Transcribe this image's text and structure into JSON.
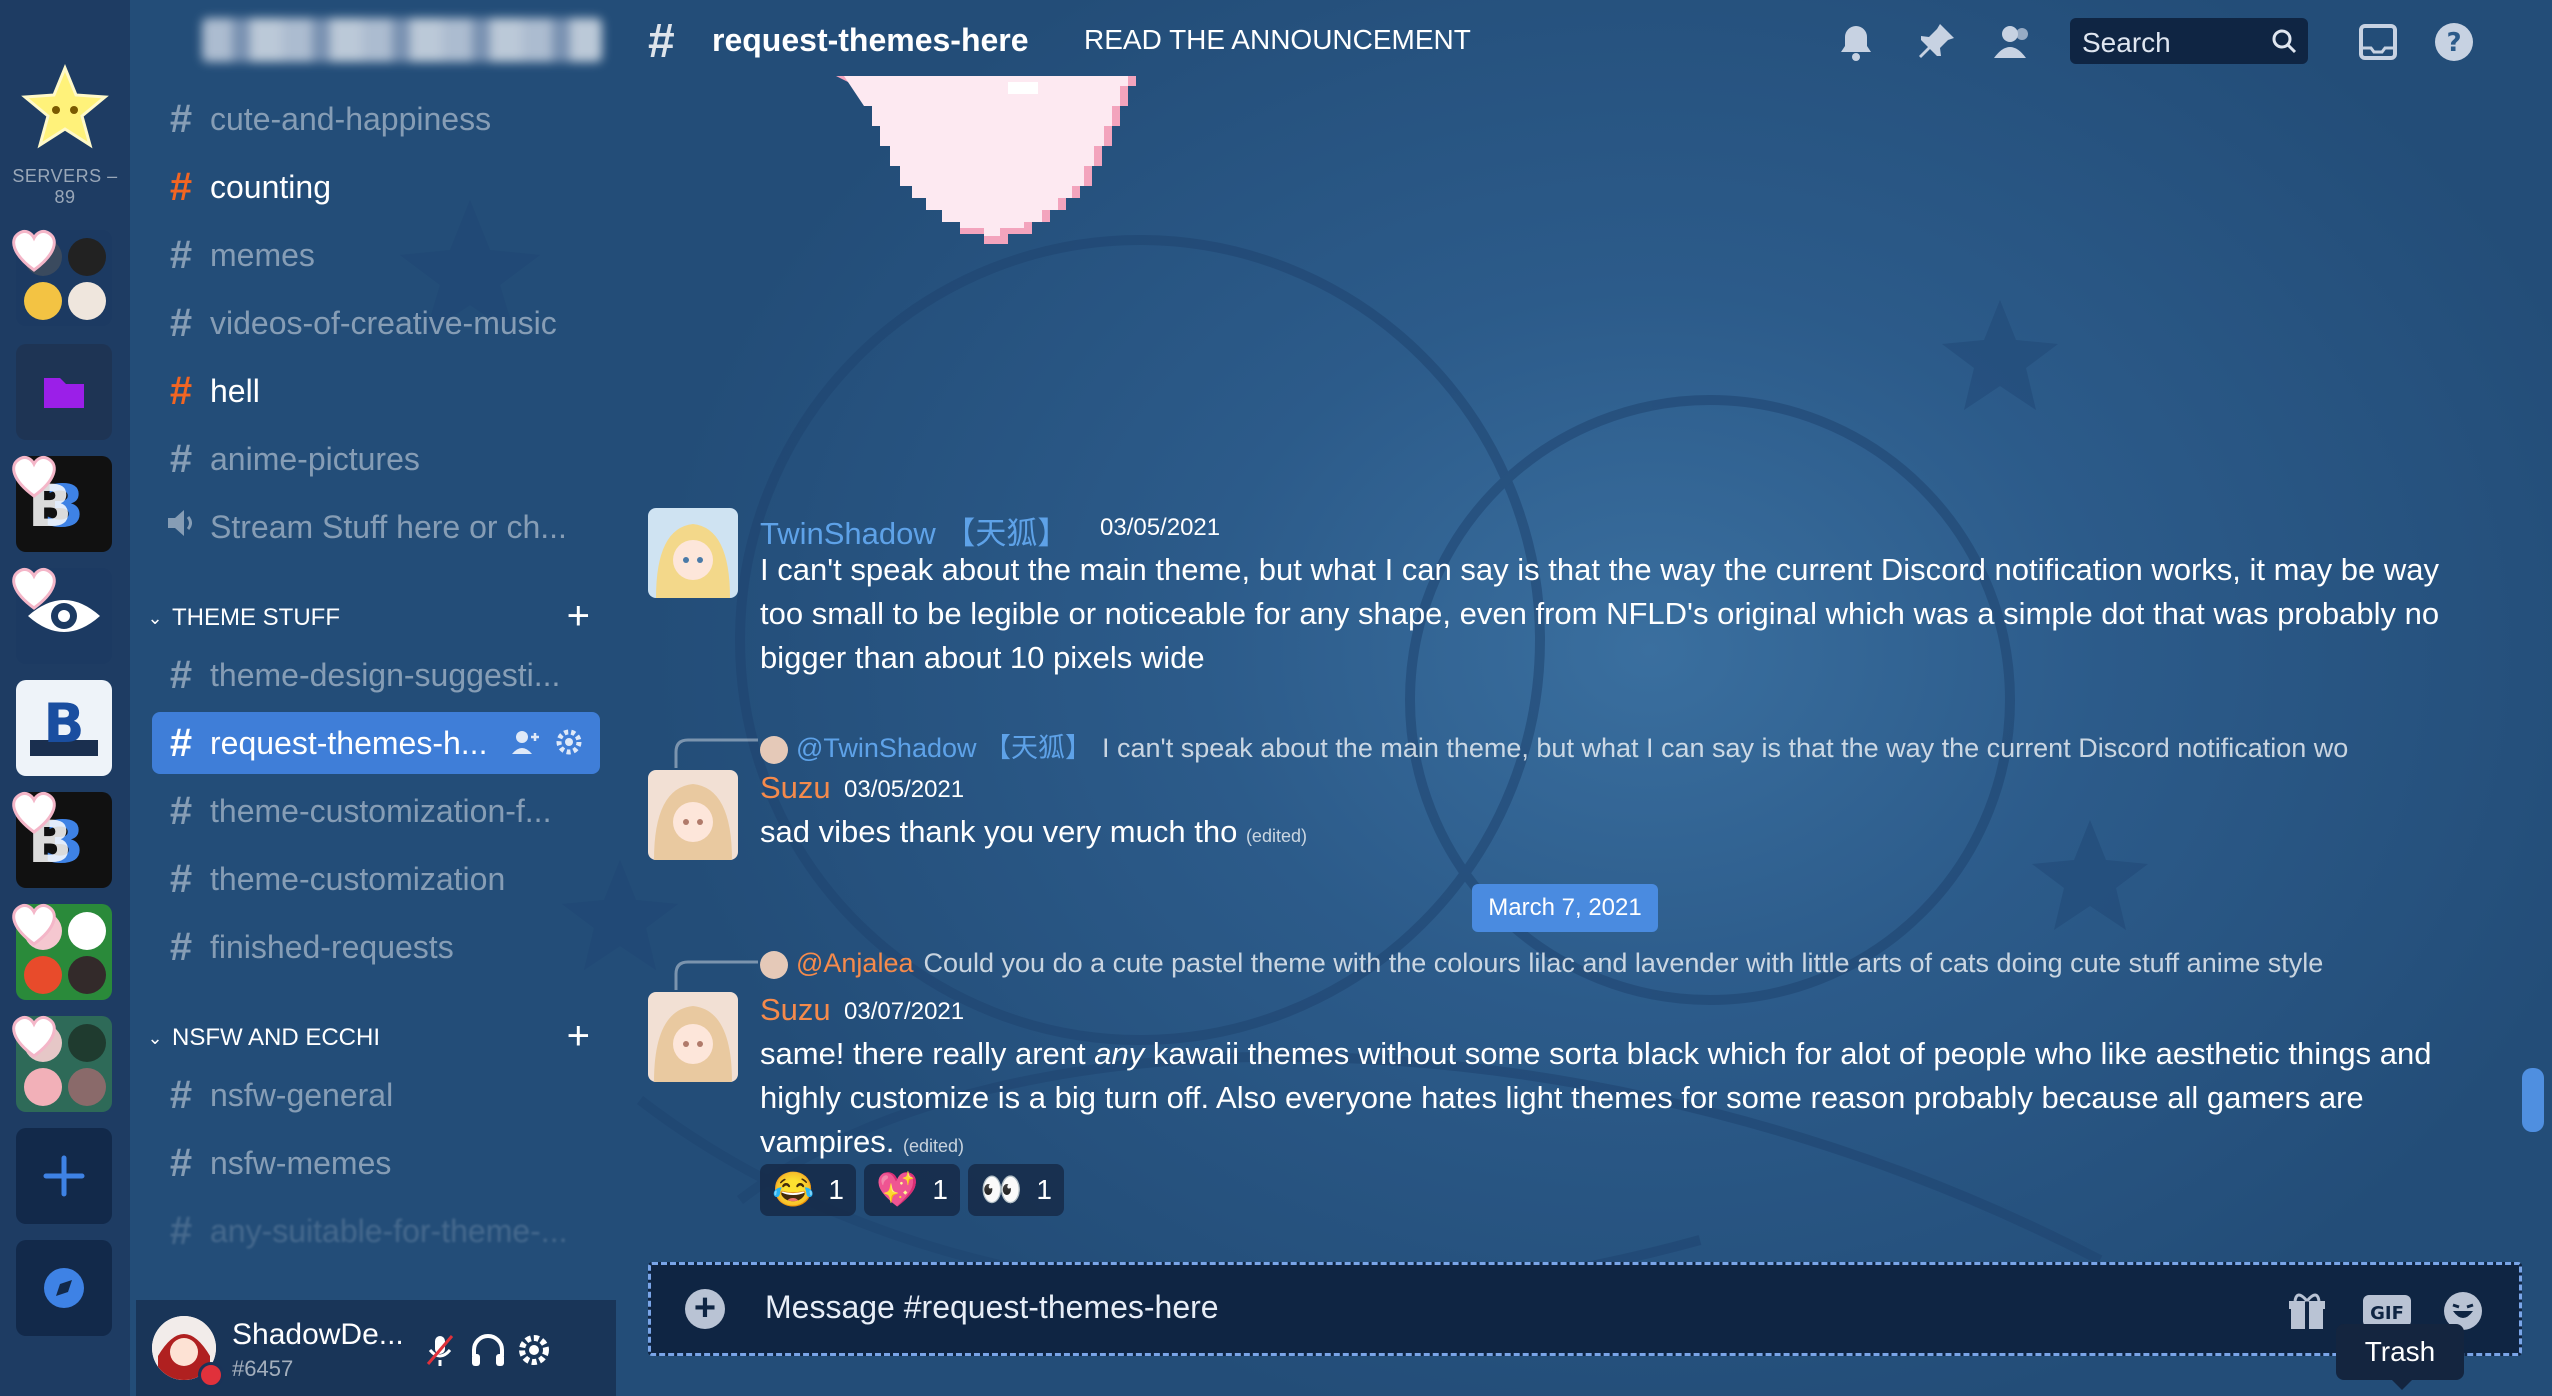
{
  "servers": {
    "count_label": "SERVERS – 89"
  },
  "sidebar": {
    "channels_top": [
      {
        "name": "cute-and-happiness",
        "style": "muted"
      },
      {
        "name": "counting",
        "style": "hot"
      },
      {
        "name": "memes",
        "style": "muted"
      },
      {
        "name": "videos-of-creative-music",
        "style": "muted"
      },
      {
        "name": "hell",
        "style": "hot"
      },
      {
        "name": "anime-pictures",
        "style": "muted"
      },
      {
        "name": "Stream Stuff here or ch...",
        "style": "voice"
      }
    ],
    "category_theme": "THEME STUFF",
    "channels_theme": [
      {
        "name": "theme-design-suggesti..."
      },
      {
        "name": "request-themes-h...",
        "active": true
      },
      {
        "name": "theme-customization-f..."
      },
      {
        "name": "theme-customization"
      },
      {
        "name": "finished-requests"
      }
    ],
    "category_nsfw": "NSFW AND ECCHI",
    "channels_nsfw": [
      {
        "name": "nsfw-general"
      },
      {
        "name": "nsfw-memes"
      },
      {
        "name": "any-suitable-for-theme-..."
      }
    ]
  },
  "user": {
    "name": "ShadowDe...",
    "tag": "#6457"
  },
  "header": {
    "channel": "request-themes-here",
    "topic": "READ THE ANNOUNCEMENT",
    "search_placeholder": "Search"
  },
  "messages": [
    {
      "author": "TwinShadow 【天狐】",
      "timestamp": "03/05/2021",
      "text": "I can't speak about the main theme, but what I can say is that the way the current Discord notification works, it may be way too small to be legible or noticeable for any shape, even from NFLD's original which was a simple dot that was probably no bigger than about 10 pixels wide"
    },
    {
      "reply_to": "@TwinShadow 【天狐】",
      "reply_text": "I can't speak about the main theme, but what I can say is that the way the current Discord notification wo",
      "author": "Suzu",
      "timestamp": "03/05/2021",
      "text": "sad vibes thank you very much tho",
      "edited": "(edited)"
    },
    {
      "reply_to": "@Anjalea",
      "reply_text": "Could you do a cute pastel theme with the colours lilac and lavender with little arts of cats doing cute stuff anime style",
      "author": "Suzu",
      "timestamp": "03/07/2021",
      "text_a": "same! there really arent ",
      "text_em": "any",
      "text_b": " kawaii themes without some sorta black which for alot of people who like aesthetic things and highly customize is a big turn off. Also everyone hates light themes for some reason probably because all gamers are vampires.",
      "edited": "(edited)",
      "reactions": [
        {
          "emoji": "😂",
          "count": "1"
        },
        {
          "emoji": "💖",
          "count": "1"
        },
        {
          "emoji": "👀",
          "count": "1"
        }
      ]
    }
  ],
  "date_divider": "March 7, 2021",
  "composer": {
    "placeholder": "Message #request-themes-here"
  },
  "tooltip": "Trash",
  "colors": {
    "accent": "#3f7ed8",
    "hot_hash": "#f26522",
    "author_blue": "#5ea2e8",
    "author_orange": "#f58a4b"
  }
}
